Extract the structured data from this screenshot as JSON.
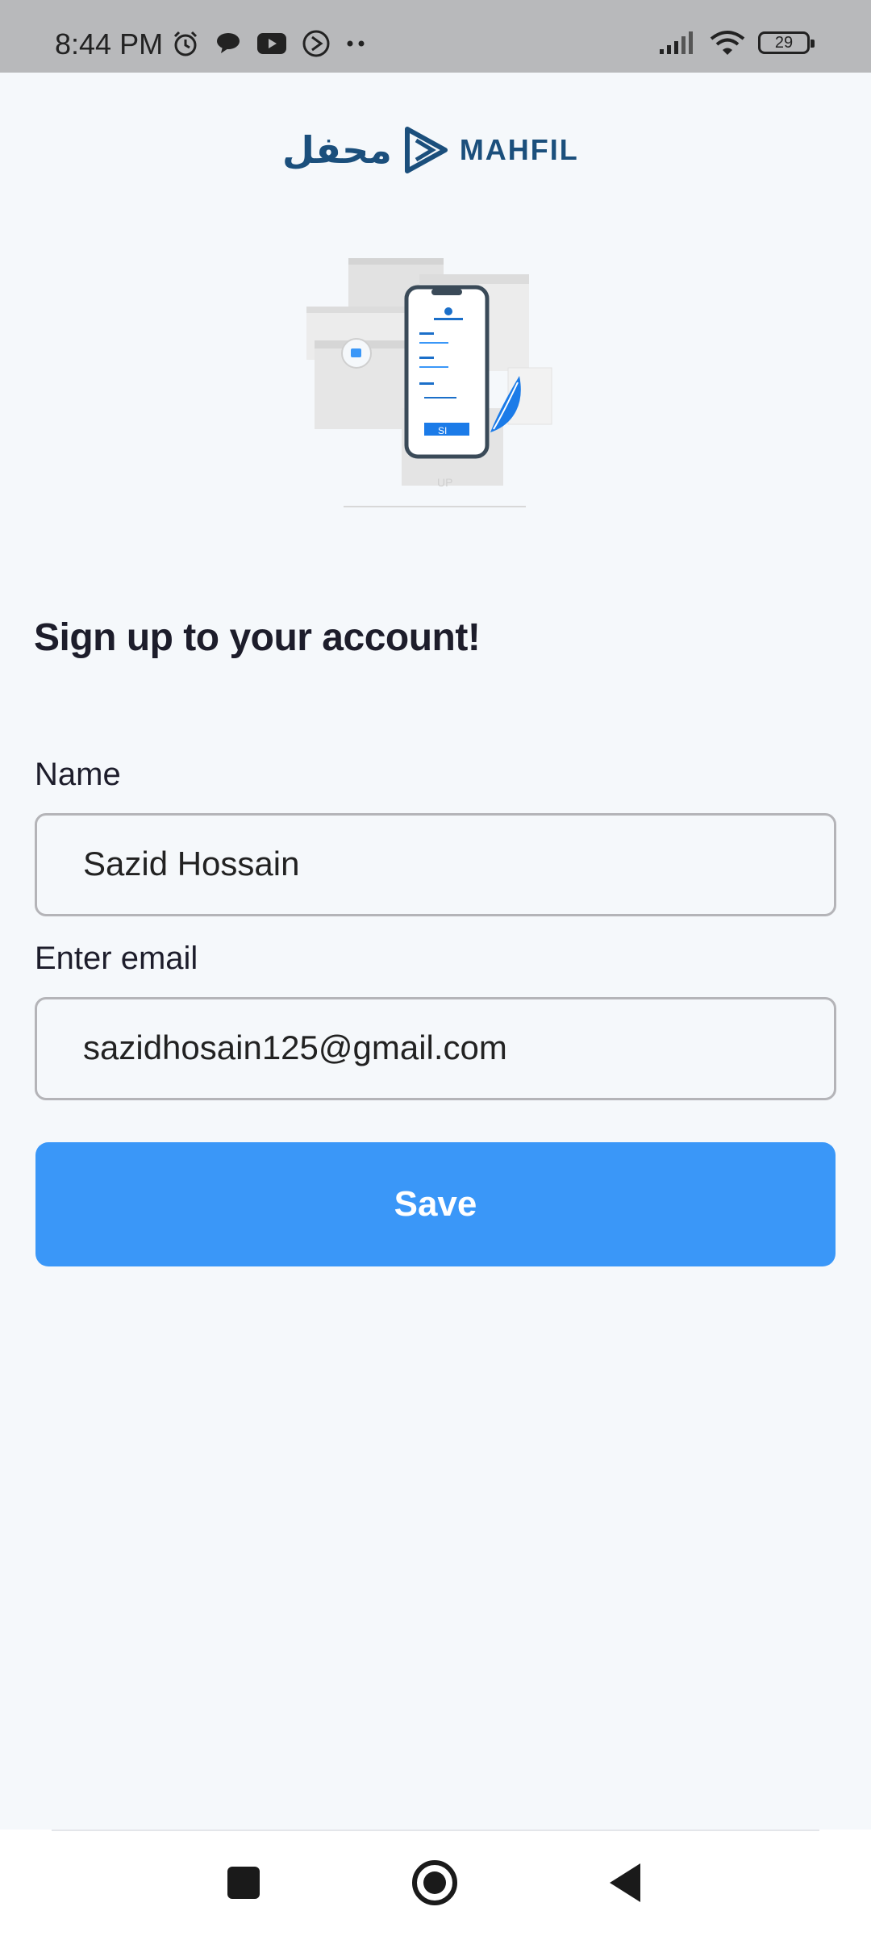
{
  "status_bar": {
    "time": "8:44 PM",
    "battery": "29",
    "icons_left": [
      "alarm-icon",
      "chat-bubble-icon",
      "youtube-icon",
      "music-icon",
      "more-dots-icon"
    ],
    "icons_right": [
      "signal-icon",
      "wifi-icon",
      "battery-icon"
    ]
  },
  "logo": {
    "arabic": "محفل",
    "text": "MAHFIL",
    "color": "#1b4f7c"
  },
  "illustration": {
    "icon": "phone-signup-illustration",
    "button_text": "SI",
    "under_text": "UP"
  },
  "form": {
    "heading": "Sign up to your account!",
    "name_label": "Name",
    "name_value": "Sazid Hossain",
    "email_label": "Enter email",
    "email_value": "sazidhosain125@gmail.com",
    "save_label": "Save",
    "accent_color": "#3a97f8"
  },
  "nav": {
    "icons": [
      "recent-apps-icon",
      "home-icon",
      "back-icon"
    ]
  }
}
